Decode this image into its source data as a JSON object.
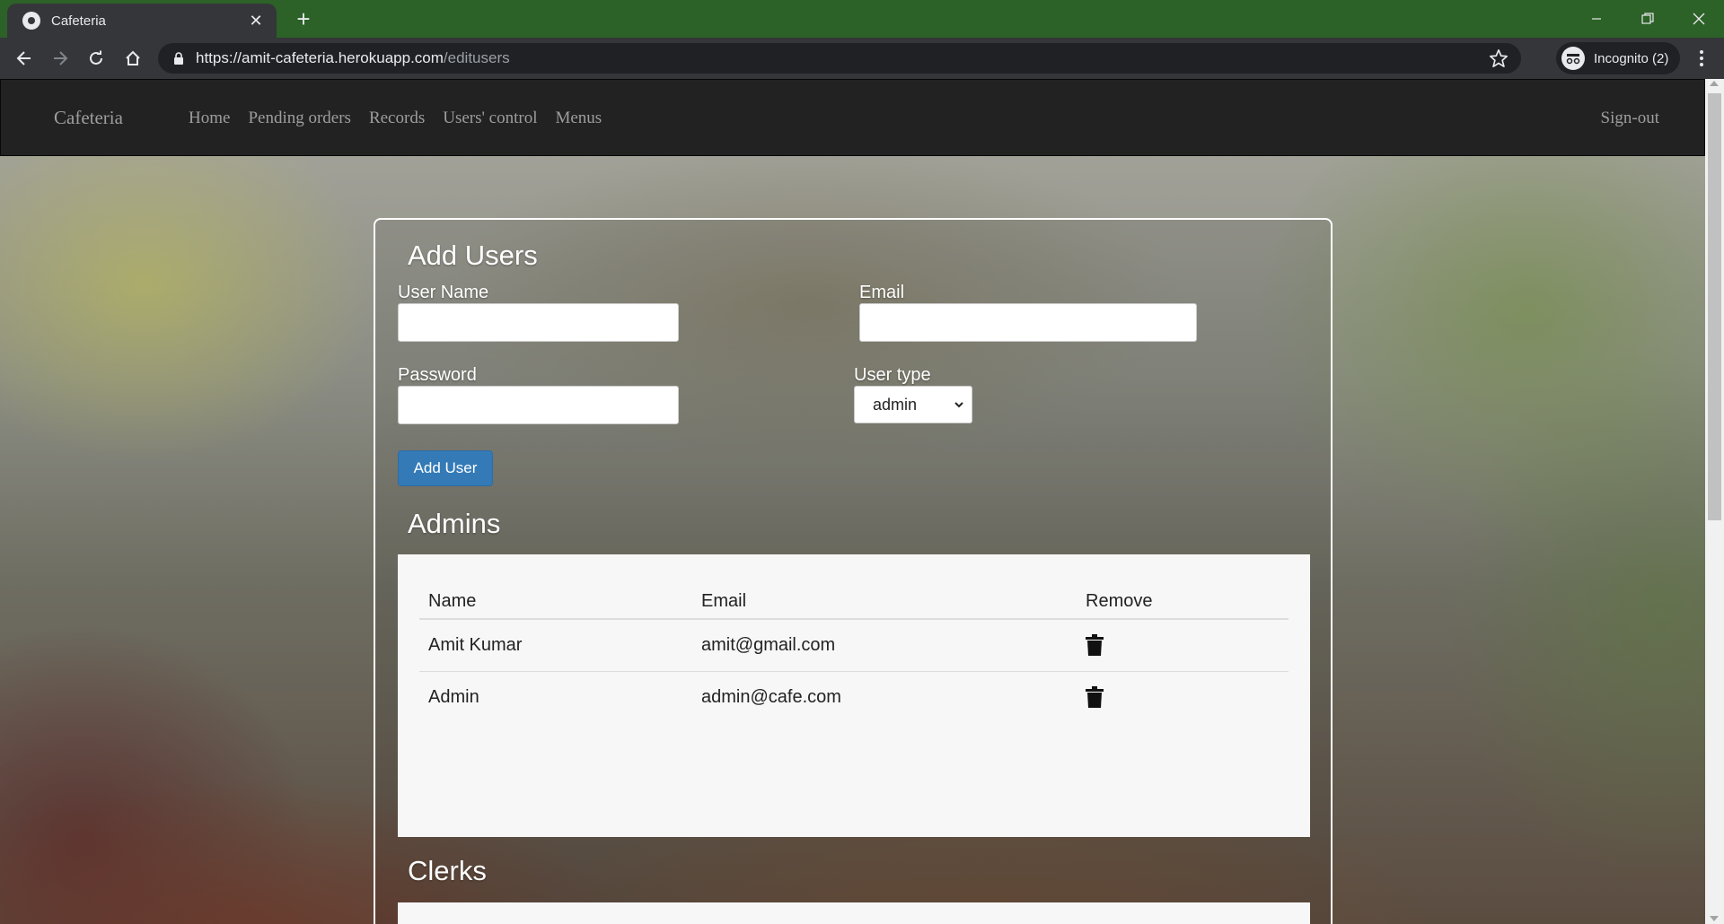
{
  "browser": {
    "tab_title": "Cafeteria",
    "url_host": "https://amit-cafeteria.herokuapp.com",
    "url_path": "/editusers",
    "incognito_label": "Incognito (2)"
  },
  "navbar": {
    "brand": "Cafeteria",
    "links": [
      "Home",
      "Pending orders",
      "Records",
      "Users' control",
      "Menus"
    ],
    "signout": "Sign-out"
  },
  "add_users": {
    "title": "Add Users",
    "username_label": "User Name",
    "username_value": "",
    "email_label": "Email",
    "email_value": "",
    "password_label": "Password",
    "password_value": "",
    "usertype_label": "User type",
    "usertype_selected": "admin",
    "submit_label": "Add User"
  },
  "admins": {
    "title": "Admins",
    "columns": [
      "Name",
      "Email",
      "Remove"
    ],
    "rows": [
      {
        "name": "Amit Kumar",
        "email": "amit@gmail.com"
      },
      {
        "name": "Admin",
        "email": "admin@cafe.com"
      }
    ]
  },
  "clerks": {
    "title": "Clerks"
  },
  "colors": {
    "tab_strip": "#2c6128",
    "navbar": "#222222",
    "primary_button": "#337ab7"
  }
}
